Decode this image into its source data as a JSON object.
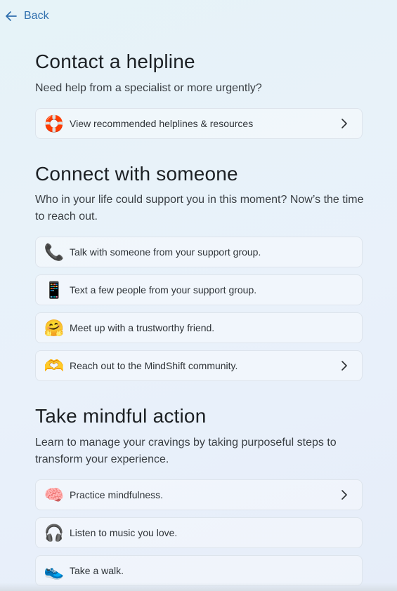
{
  "nav": {
    "back_label": "Back"
  },
  "helpline": {
    "title": "Contact a helpline",
    "description": "Need help from a specialist or more urgently?",
    "items": [
      {
        "icon": "lifebuoy-icon",
        "label": "View recommended helplines & resources",
        "has_chevron": true
      }
    ]
  },
  "connect": {
    "title": "Connect with someone",
    "description": "Who in your life could support you in this moment? Now’s the time to reach out.",
    "items": [
      {
        "icon": "phone-icon",
        "label": "Talk with someone from your support group."
      },
      {
        "icon": "mobile-phone-icon",
        "label": "Text a few people from your support group."
      },
      {
        "icon": "hugging-face-icon",
        "label": "Meet up with a trustworthy friend."
      },
      {
        "icon": "heart-hands-icon",
        "label": "Reach out to the MindShift community.",
        "has_chevron": true
      }
    ]
  },
  "mindful": {
    "title": "Take mindful action",
    "description": "Learn to manage your cravings by taking purposeful steps to transform your experience.",
    "items": [
      {
        "icon": "brain-icon",
        "label": "Practice mindfulness.",
        "has_chevron": true
      },
      {
        "icon": "headphones-icon",
        "label": "Listen to music you love."
      },
      {
        "icon": "sneaker-icon",
        "label": "Take a walk."
      }
    ]
  },
  "colors": {
    "link": "#2f6fae",
    "heading": "#1c2024",
    "card_border": "#dde4ec"
  }
}
